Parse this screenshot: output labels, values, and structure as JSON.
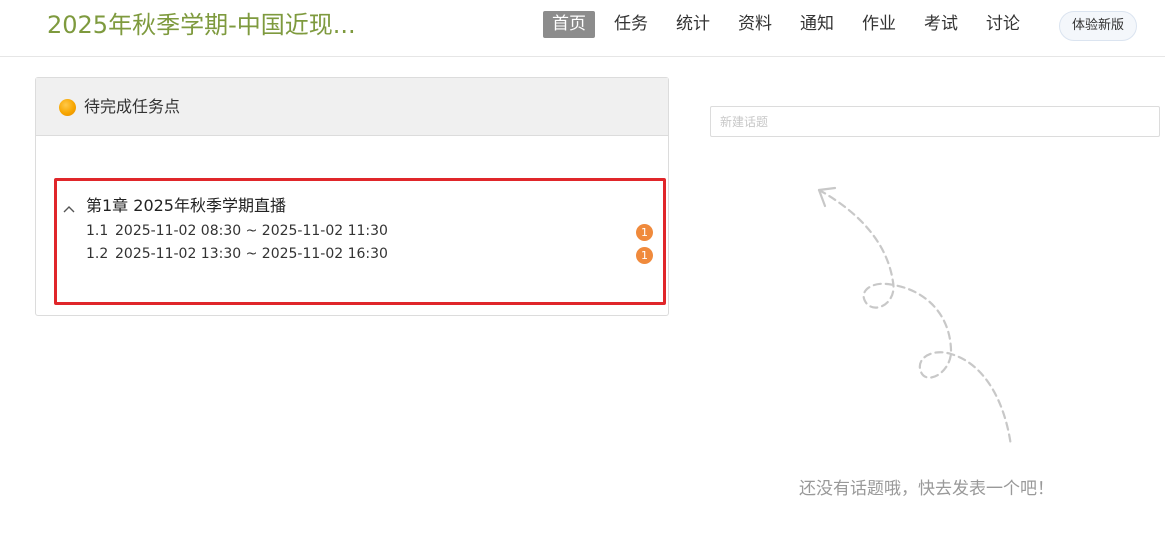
{
  "header": {
    "course_title": "2025年秋季学期-中国近现...",
    "nav": [
      {
        "label": "首页",
        "active": true
      },
      {
        "label": "任务",
        "active": false
      },
      {
        "label": "统计",
        "active": false
      },
      {
        "label": "资料",
        "active": false
      },
      {
        "label": "通知",
        "active": false
      },
      {
        "label": "作业",
        "active": false
      },
      {
        "label": "考试",
        "active": false
      },
      {
        "label": "讨论",
        "active": false
      }
    ],
    "new_version_label": "体验新版",
    "title_color": "#7e9a3e"
  },
  "tasks": {
    "title": "待完成任务点",
    "chapter": {
      "title": "第1章 2025年秋季学期直播",
      "expanded": true,
      "lessons": [
        {
          "num": "1.1",
          "label": "2025-11-02 08:30 ~ 2025-11-02 11:30",
          "badge": "1"
        },
        {
          "num": "1.2",
          "label": "2025-11-02 13:30 ~ 2025-11-02 16:30",
          "badge": "1"
        }
      ]
    },
    "highlight_color": "#e0262a",
    "badge_color": "#f08a3c"
  },
  "discussion": {
    "new_topic_placeholder": "新建话题",
    "empty_text": "还没有话题哦，快去发表一个吧！"
  }
}
